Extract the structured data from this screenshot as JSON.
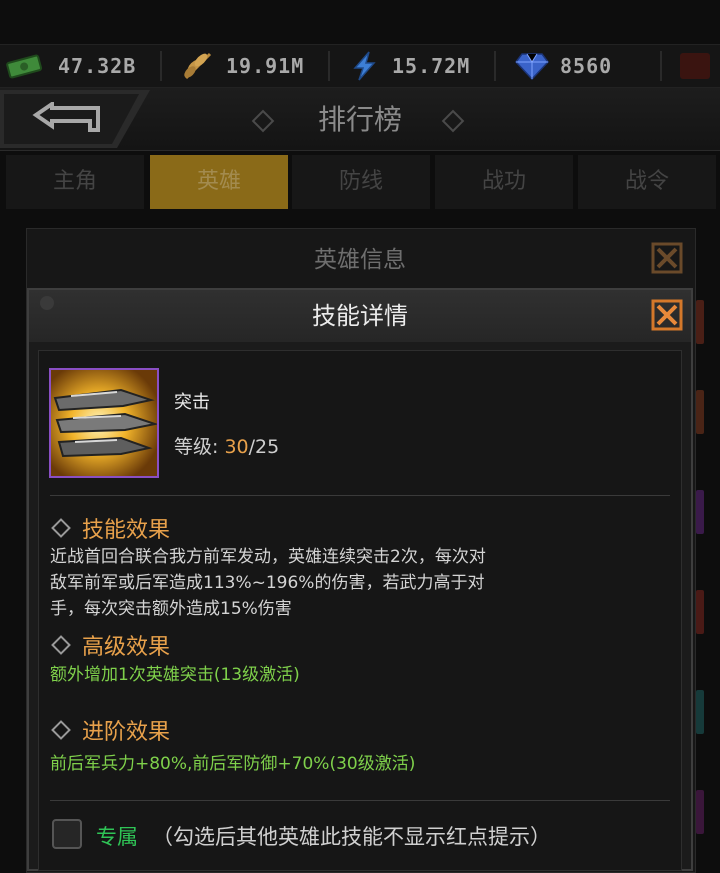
{
  "resources": [
    {
      "icon": "cash-icon",
      "value": "47.32B"
    },
    {
      "icon": "wheat-icon",
      "value": "19.91M"
    },
    {
      "icon": "lightning-icon",
      "value": "15.72M"
    },
    {
      "icon": "diamond-icon",
      "value": "8560"
    }
  ],
  "header": {
    "title": "排行榜"
  },
  "tabs": [
    {
      "label": "主角"
    },
    {
      "label": "英雄",
      "active": true
    },
    {
      "label": "防线"
    },
    {
      "label": "战功"
    },
    {
      "label": "战令"
    }
  ],
  "hero_info": {
    "title": "英雄信息"
  },
  "skill_detail": {
    "title": "技能详情",
    "name": "突击",
    "level_label": "等级: ",
    "level_current": "30",
    "level_max": "/25",
    "effect_title": "技能效果",
    "effect_lines": [
      "近战首回合联合我方前军发动，英雄连续突击2次，每次对",
      "敌军前军或后军造成113%~196%的伤害，若武力高于对",
      "手，每次突击额外造成15%伤害"
    ],
    "advanced_title": "高级效果",
    "advanced_text": "额外增加1次英雄突击(13级激活)",
    "promotion_title": "进阶效果",
    "promotion_text": "前后军兵力+80%,前后军防御+70%(30级激活)",
    "exclusive_label": "专属",
    "exclusive_hint": "（勾选后其他英雄此技能不显示红点提示）"
  },
  "colors": {
    "accent": "#e8a14b",
    "green": "#7fd14b",
    "exclusive": "#2fc456",
    "tab_active": "#8a6a18"
  }
}
